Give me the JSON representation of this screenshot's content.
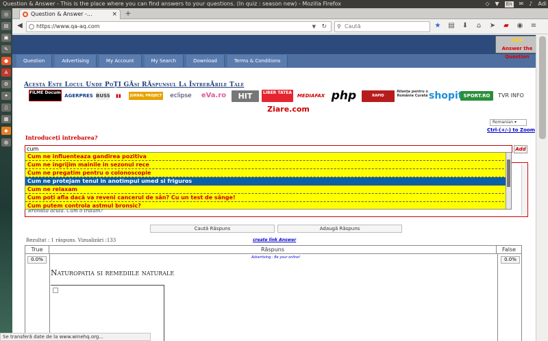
{
  "window": {
    "title": "Question & Answer - This is the place where you can find answers to your questions. (In quiz : season new) - Mozilla Firefox"
  },
  "tray": {
    "lang": "En",
    "user": "Adi"
  },
  "browser": {
    "tab_title": "Question & Answer -...",
    "url": "https://www.qa-aq.com",
    "search_placeholder": "Caută",
    "status": "Se transferă date de la www.winehq.org..."
  },
  "site": {
    "logo_top": "Q&A",
    "logo_bottom": "Answer the Question",
    "menu": [
      "Question",
      "Advertising",
      "My Account",
      "My Search",
      "Download",
      "Terms & Conditions"
    ],
    "tagline": "Acesta Este Locul Unde PoȚI GĂsi RĂspunsul La ÎntrebĂrile Tale",
    "language": "Romanian",
    "zoom_hint": "Ctrl-(+/-) to Zoom",
    "question_label": "Introduceți intrebarea?",
    "question_value": "cum",
    "add_label": "Add",
    "result_preview": "Bronsita acuta. Cum o tratam?",
    "suggestions": [
      "Cum ne influenteaza gandirea pozitiva",
      "Cum ne ingrijim mainile in sezonul rece",
      "Cum ne pregatim pentru o colonoscopie",
      "Cum ne protejam tenul in anotimpul umed si friguros",
      "Cum ne relaxam",
      "Cum poți afla dacă va reveni cancerul de sân? Cu un test de sânge!",
      "Cum putem controla astmul bronsic?"
    ],
    "selected_index": 3,
    "search_btn": "Caută Răspuns",
    "add_answer_btn": "Adaugă Răspuns",
    "stats": "Rezultat : 1 răspuns. Vizualizări :133",
    "create_link": "create link Answer",
    "col_true": "True",
    "col_answer": "Răspuns",
    "col_false": "False",
    "true_pct": "0.0%",
    "false_pct": "0.0%",
    "ad_text": "Advertising : Be your online!",
    "answer_title": "Naturopatia si remediile naturale"
  },
  "partners": [
    "FILME Documentare",
    "AGERPRES",
    "BUSS",
    "JURNAL PROJECT",
    "eclipse",
    "eVa.ro",
    "HIT",
    "LIBER TATEA",
    "MEDIAFAX",
    "php",
    "RAPID",
    "Alianța pentru o Românie Curată",
    "shopit",
    "SPORT.RO",
    "TVR INFO",
    "Ziare.com"
  ],
  "colors": {
    "banner": "#2c4a7c",
    "menu": "#4e6fa0",
    "accent_red": "#cc0000",
    "suggest_bg": "#ffff00",
    "select_bg": "#0b5fa5"
  }
}
